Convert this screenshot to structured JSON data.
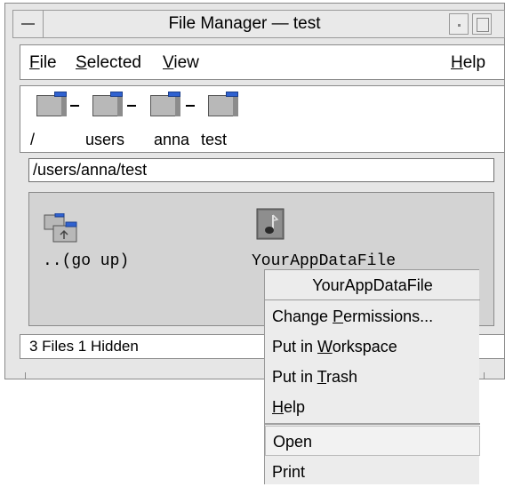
{
  "window": {
    "title": "File Manager — test",
    "window_menu_icon": "window-menu-icon",
    "minimize_icon": "minimize-icon",
    "maximize_icon": "maximize-icon"
  },
  "menubar": {
    "file": {
      "pre": "",
      "u": "F",
      "post": "ile"
    },
    "selected": {
      "pre": "",
      "u": "S",
      "post": "elected"
    },
    "view": {
      "pre": "",
      "u": "V",
      "post": "iew"
    },
    "help": {
      "pre": "",
      "u": "H",
      "post": "elp"
    }
  },
  "breadcrumbs": [
    "/",
    "users",
    "anna",
    "test"
  ],
  "folder_icon": "folder-icon",
  "path": "/users/anna/test",
  "files": [
    {
      "label": "..(go up)",
      "icon": "go-up-folder-icon"
    },
    {
      "label": "YourAppDataFile",
      "icon": "data-file-icon"
    }
  ],
  "status": "3 Files 1 Hidden",
  "popup": {
    "title": "YourAppDataFile",
    "items": [
      {
        "pre": "Change ",
        "u": "P",
        "post": "ermissions..."
      },
      {
        "pre": "Put in ",
        "u": "W",
        "post": "orkspace"
      },
      {
        "pre": "Put in ",
        "u": "T",
        "post": "rash"
      },
      {
        "pre": "",
        "u": "H",
        "post": "elp"
      }
    ],
    "actions": [
      {
        "label": "Open"
      },
      {
        "label": "Print"
      }
    ]
  },
  "colors": {
    "folder_tab": "#2f61d0",
    "file_area_bg": "#d3d3d3",
    "chrome_bg": "#e6e6e6"
  }
}
